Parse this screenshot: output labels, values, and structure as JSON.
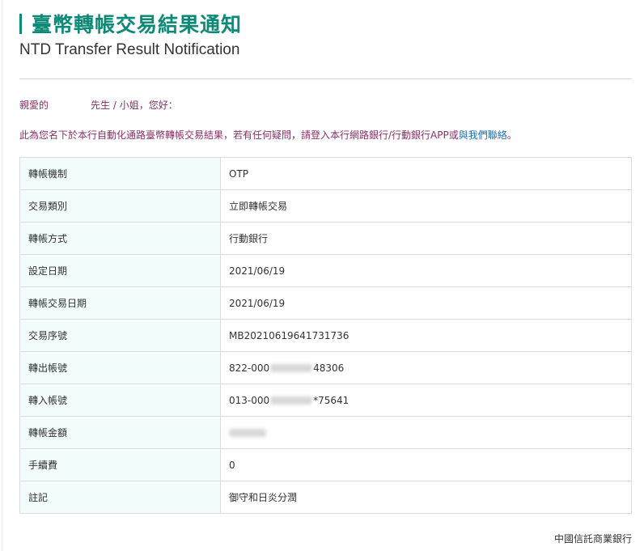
{
  "header": {
    "title": "臺幣轉帳交易結果通知",
    "subtitle": "NTD Transfer Result Notification"
  },
  "greeting": {
    "salutation": "親愛的",
    "honorific": "先生 / 小姐，您好："
  },
  "intro": {
    "text_before_link": "此為您名下於本行自動化通路臺幣轉帳交易結果，若有任何疑問，請登入本行網路銀行/行動銀行APP或",
    "link_text": "與我們聯絡",
    "text_after_link": "。"
  },
  "details": {
    "rows": [
      {
        "label": "轉帳機制",
        "value": "OTP"
      },
      {
        "label": "交易類別",
        "value": "立即轉帳交易"
      },
      {
        "label": "轉帳方式",
        "value": "行動銀行"
      },
      {
        "label": "設定日期",
        "value": "2021/06/19"
      },
      {
        "label": "轉帳交易日期",
        "value": "2021/06/19"
      },
      {
        "label": "交易序號",
        "value": "MB20210619641731736"
      },
      {
        "label": "轉出帳號",
        "value_prefix": "822-000",
        "value_suffix": "48306"
      },
      {
        "label": "轉入帳號",
        "value_prefix": "013-000",
        "value_suffix": "*75641"
      },
      {
        "label": "轉帳金額",
        "value": ""
      },
      {
        "label": "手續費",
        "value": "0"
      },
      {
        "label": "註記",
        "value": "御守和日炎分潤"
      }
    ]
  },
  "footer": {
    "bank_name": "中國信託商業銀行"
  },
  "colors": {
    "accent": "#0d8a77",
    "greeting_text": "#8b2f64",
    "link": "#1c6fb0",
    "label_cell_bg": "#f2fcfd",
    "border": "#dcdcdc"
  }
}
